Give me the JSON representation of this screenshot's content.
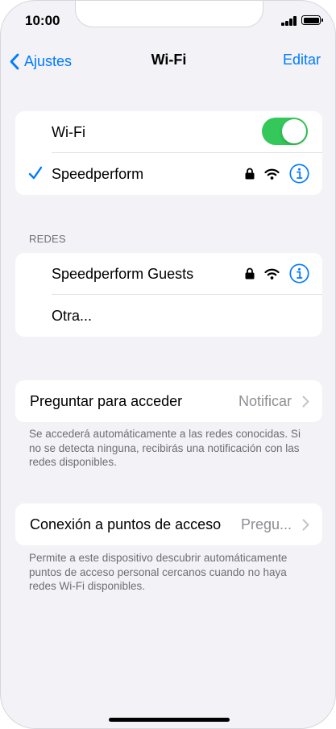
{
  "status_bar": {
    "time": "10:00",
    "signal_bars": 4,
    "battery_level": 1.0
  },
  "nav": {
    "back_label": "Ajustes",
    "title": "Wi-Fi",
    "edit_label": "Editar",
    "accent_color": "#007aff"
  },
  "wifi_group": {
    "wifi_label": "Wi-Fi",
    "wifi_enabled": true,
    "toggle_color": "#34c759",
    "connected_network": "Speedperform",
    "connected_icons": [
      "lock-icon",
      "wifi-signal-icon",
      "info-icon"
    ]
  },
  "networks": {
    "header": "REDES",
    "items": [
      {
        "name": "Speedperform Guests",
        "icons": [
          "lock-icon",
          "wifi-signal-icon",
          "info-icon"
        ]
      },
      {
        "name": "Otra..."
      }
    ]
  },
  "ask_to_join": {
    "label": "Preguntar para acceder",
    "value": "Notificar",
    "footnote": "Se accederá automáticamente a las redes conocidas. Si no se detecta ninguna, recibirás una notificación con las redes disponibles."
  },
  "hotspot": {
    "label": "Conexión a puntos de acceso",
    "value": "Pregu...",
    "footnote": "Permite a este dispositivo descubrir automáticamente puntos de acceso personal cercanos cuando no haya redes Wi-Fi disponibles."
  }
}
